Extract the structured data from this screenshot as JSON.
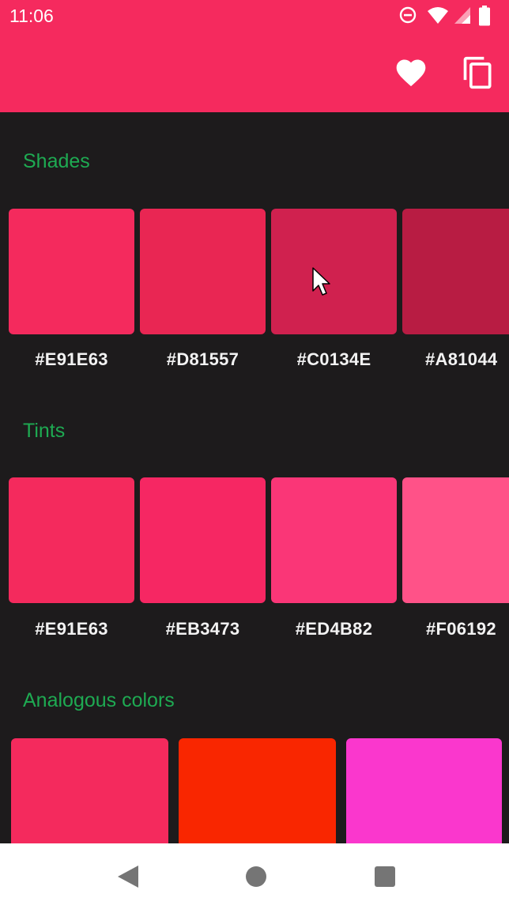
{
  "status_bar": {
    "time": "11:06",
    "icons": [
      "do-not-disturb-icon",
      "wifi-icon",
      "cellular-signal-icon",
      "battery-icon"
    ]
  },
  "app_bar": {
    "background": "#F52A5E",
    "actions": [
      "favorite-heart-icon",
      "copy-icon"
    ]
  },
  "shades": {
    "title": "Shades",
    "items": [
      {
        "hex": "#E91E63",
        "color": "#F42A5D"
      },
      {
        "hex": "#D81557",
        "color": "#E92653"
      },
      {
        "hex": "#C0134E",
        "color": "#D0214F"
      },
      {
        "hex": "#A81044",
        "color": "#B81C43"
      }
    ]
  },
  "tints": {
    "title": "Tints",
    "items": [
      {
        "hex": "#E91E63",
        "color": "#F42A5D"
      },
      {
        "hex": "#EB3473",
        "color": "#F62763"
      },
      {
        "hex": "#ED4B82",
        "color": "#FA3677"
      },
      {
        "hex": "#F06192",
        "color": "#FF5288"
      }
    ]
  },
  "analogous": {
    "title": "Analogous colors",
    "items": [
      {
        "color": "#F42A5D"
      },
      {
        "color": "#F92600"
      },
      {
        "color": "#FA37CD"
      }
    ]
  },
  "navigation_bar": {
    "buttons": [
      "back-icon",
      "home-icon",
      "recents-icon"
    ]
  }
}
